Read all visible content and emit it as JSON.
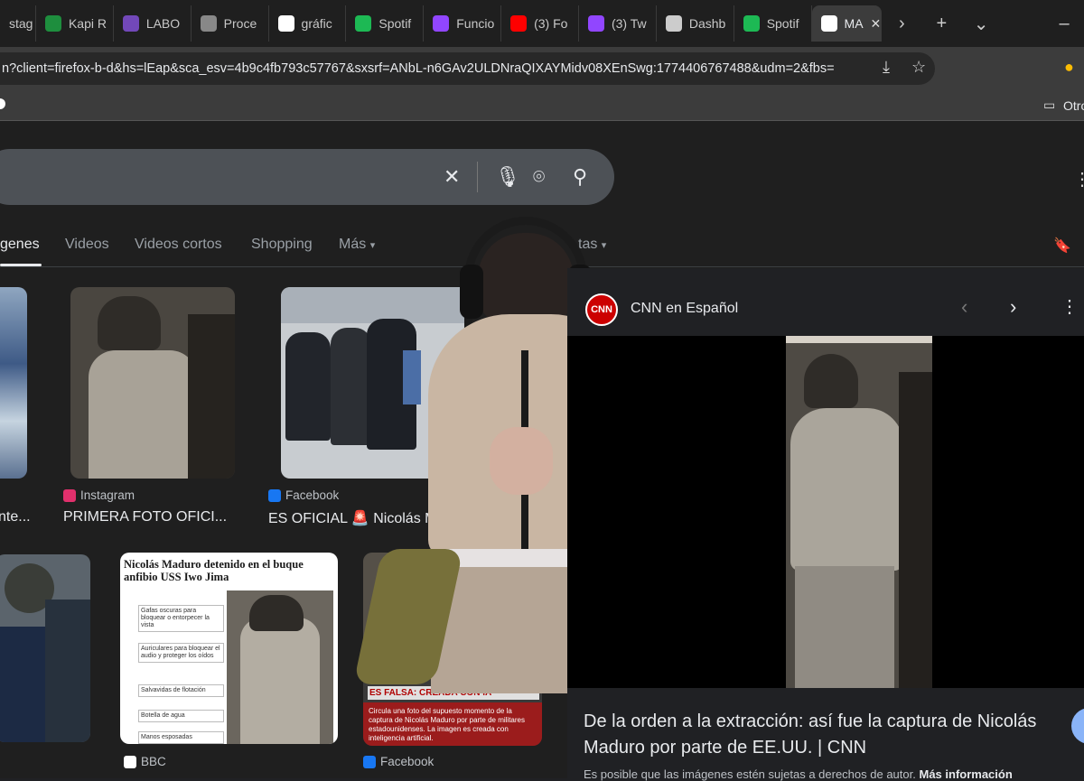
{
  "tabs": [
    {
      "label": "stag",
      "icon": "instagram-icon",
      "color": "#c13584"
    },
    {
      "label": "Kapi R",
      "icon": "sheets-icon",
      "color": "#1e8e3e"
    },
    {
      "label": "LABO",
      "icon": "form-icon",
      "color": "#7248b9"
    },
    {
      "label": "Proce",
      "icon": "globe-icon",
      "color": "#888888"
    },
    {
      "label": "gráfic",
      "icon": "google-icon",
      "color": "#ffffff"
    },
    {
      "label": "Spotif",
      "icon": "spotify-icon",
      "color": "#1db954"
    },
    {
      "label": "Funcio",
      "icon": "twitch-icon",
      "color": "#9146ff"
    },
    {
      "label": "(3) Fo",
      "icon": "youtube-icon",
      "color": "#ff0000"
    },
    {
      "label": "(3) Tw",
      "icon": "twitch-icon",
      "color": "#9146ff"
    },
    {
      "label": "Dashb",
      "icon": "discord-icon",
      "color": "#cccccc"
    },
    {
      "label": "Spotif",
      "icon": "spotify-icon",
      "color": "#1db954"
    },
    {
      "label": "MA",
      "icon": "google-icon",
      "color": "#ffffff",
      "active": true
    }
  ],
  "url": "n?client=firefox-b-d&hs=lEap&sca_esv=4b9c4fb793c57767&sxsrf=ANbL-n6GAv2ULDNraQIXAYMidv08XEnSwg:1774406767488&udm=2&fbs=",
  "bookmarks": {
    "other": "Otro"
  },
  "filters": [
    "genes",
    "Videos",
    "Videos cortos",
    "Shopping",
    "Más",
    "tas"
  ],
  "results": [
    {
      "source": "Instagram",
      "caption": "PRIMERA FOTO OFICI...",
      "source_color": "#e1306c"
    },
    {
      "source": "Facebook",
      "caption": "ES OFICIAL 🚨 Nicolás M",
      "source_color": "#1877f2"
    },
    {
      "source": "BBC",
      "caption": "",
      "source_color": "#ffffff"
    },
    {
      "source": "Facebook",
      "caption": "",
      "source_color": "#1877f2"
    }
  ],
  "left_caption": "nte...",
  "bbc_card": {
    "title": "Nicolás Maduro detenido en el buque anfibio USS Iwo Jima",
    "labels": [
      "Gafas oscuras para bloquear o entorpecer la vista",
      "Auriculares para bloquear el audio y proteger los oídos",
      "Salvavidas de flotación",
      "Botella de agua",
      "Manos esposadas"
    ]
  },
  "fb_card": {
    "banner": "ES FALSA: CREADA CON IA",
    "body": "Circula una foto del supuesto momento de la captura de Nicolás Maduro por parte de militares estadounidenses. La imagen es creada con inteligencia artificial."
  },
  "panel": {
    "source": "CNN en Español",
    "logo": "CNN",
    "headline": "De la orden a la extracción: así fue la captura de Nicolás Maduro por parte de EE.UU. | CNN",
    "disclaimer": "Es posible que las imágenes estén sujetas a derechos de autor.",
    "more_info": "Más información"
  }
}
